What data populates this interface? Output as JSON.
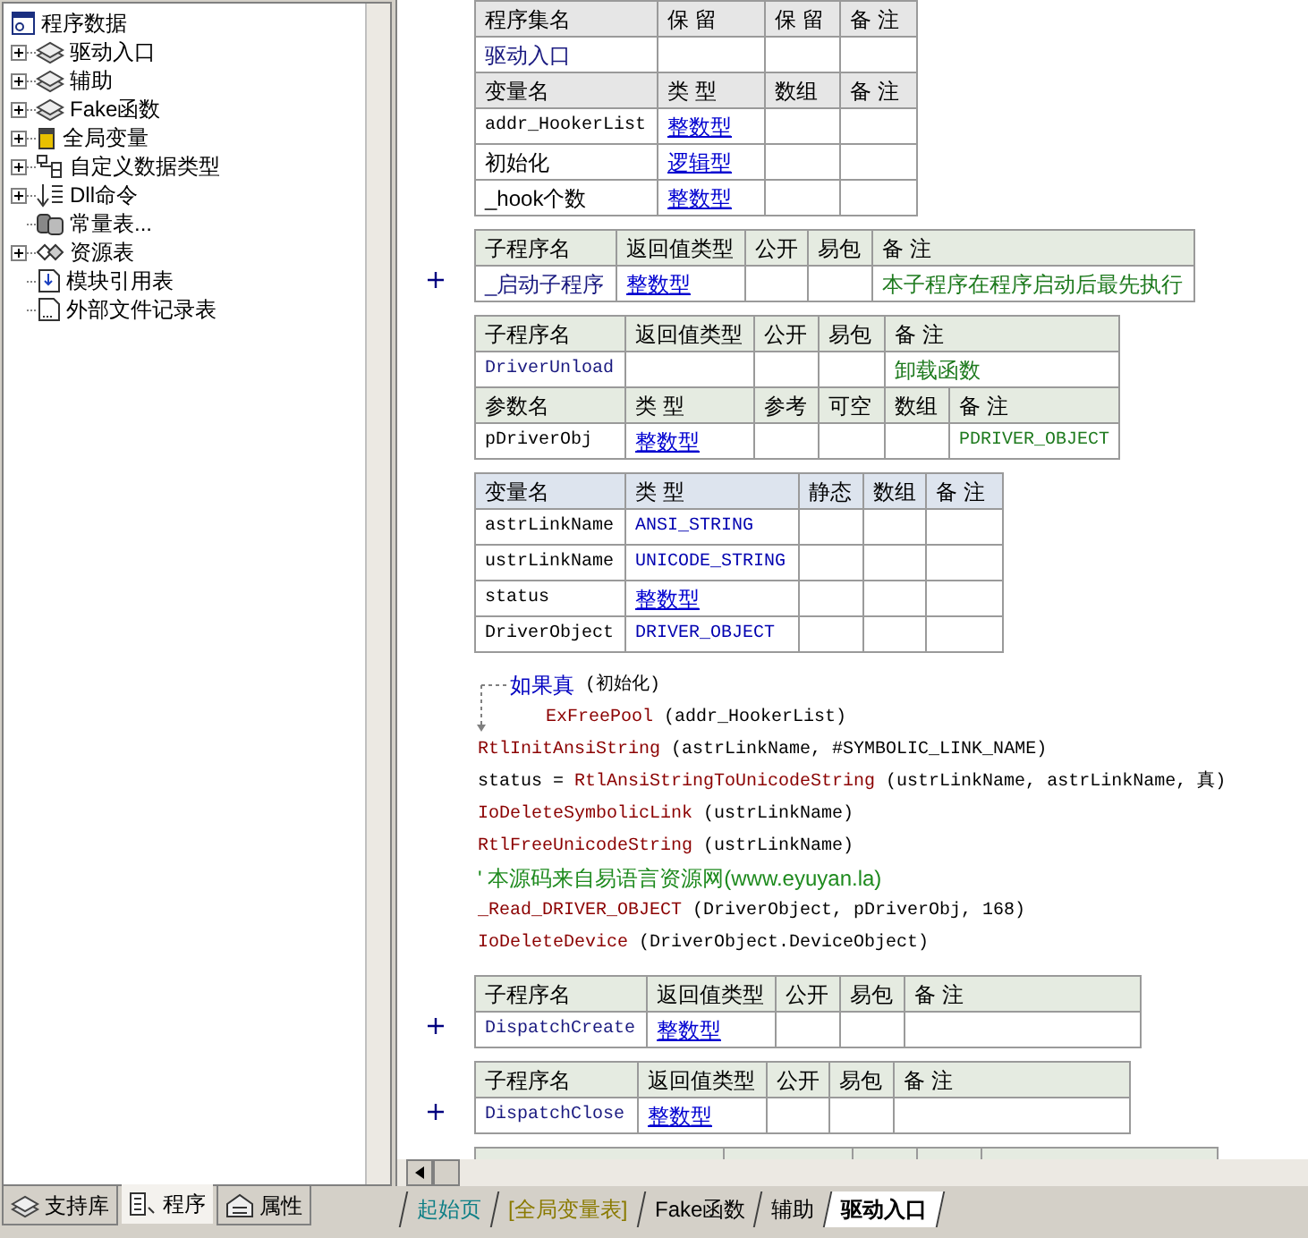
{
  "tree": {
    "label": "程序数据",
    "children": [
      {
        "label": "驱动入口",
        "kind": "module",
        "expandable": true
      },
      {
        "label": "辅助",
        "kind": "module",
        "expandable": true
      },
      {
        "label": "Fake函数",
        "kind": "module",
        "expandable": true
      },
      {
        "label": "全局变量",
        "kind": "global",
        "expandable": true
      },
      {
        "label": "自定义数据类型",
        "kind": "datatype",
        "expandable": true
      },
      {
        "label": "Dll命令",
        "kind": "dll",
        "expandable": true
      },
      {
        "label": "常量表...",
        "kind": "constant",
        "expandable": false
      },
      {
        "label": "资源表",
        "kind": "resource",
        "expandable": true
      },
      {
        "label": "模块引用表",
        "kind": "modref",
        "expandable": false
      },
      {
        "label": "外部文件记录表",
        "kind": "file",
        "expandable": false
      }
    ]
  },
  "panel_tabs": [
    {
      "label": "支持库",
      "kind": "library",
      "selected": false
    },
    {
      "label": "程序",
      "kind": "program",
      "selected": true
    },
    {
      "label": "属性",
      "kind": "properties",
      "selected": false
    }
  ],
  "blocks": [
    {
      "kind": "assembly",
      "rows": [
        {
          "cells": [
            {
              "kind": "head",
              "text": "程序集名"
            },
            {
              "kind": "head",
              "text": "保 留"
            },
            {
              "kind": "head",
              "text": "保 留"
            },
            {
              "kind": "head",
              "text": "备 注"
            }
          ]
        },
        {
          "cells": [
            {
              "kind": "name",
              "text": "驱动入口"
            },
            {},
            {},
            {}
          ]
        },
        {
          "cells": [
            {
              "kind": "head",
              "text": "变量名"
            },
            {
              "kind": "head",
              "text": "类 型"
            },
            {
              "kind": "head",
              "text": "数组"
            },
            {
              "kind": "head",
              "text": "备 注"
            }
          ]
        },
        {
          "cells": [
            {
              "kind": "mono",
              "text": "addr_HookerList"
            },
            {
              "kind": "type",
              "text": "整数型"
            },
            {},
            {}
          ]
        },
        {
          "cells": [
            {
              "kind": "text",
              "text": "初始化"
            },
            {
              "kind": "type",
              "text": "逻辑型"
            },
            {},
            {}
          ]
        },
        {
          "cells": [
            {
              "kind": "text",
              "text": "_hook个数"
            },
            {
              "kind": "type",
              "text": "整数型"
            },
            {},
            {}
          ]
        }
      ]
    },
    {
      "kind": "subroutine",
      "expanded": false,
      "rows": [
        {
          "cells": [
            {
              "kind": "head",
              "text": "子程序名"
            },
            {
              "kind": "head",
              "text": "返回值类型"
            },
            {
              "kind": "head",
              "text": "公开"
            },
            {
              "kind": "head",
              "text": "易包"
            },
            {
              "kind": "head",
              "text": "备 注"
            }
          ]
        },
        {
          "cells": [
            {
              "kind": "name",
              "text": "_启动子程序"
            },
            {
              "kind": "type",
              "text": "整数型"
            },
            {},
            {},
            {
              "kind": "note",
              "text": "本子程序在程序启动后最先执行"
            }
          ]
        }
      ]
    },
    {
      "kind": "subroutine",
      "expanded": true,
      "rows": [
        {
          "cells": [
            {
              "kind": "head",
              "text": "子程序名"
            },
            {
              "kind": "head",
              "text": "返回值类型"
            },
            {
              "kind": "head",
              "text": "公开"
            },
            {
              "kind": "head",
              "text": "易包"
            },
            {
              "kind": "head",
              "text": "备 注"
            }
          ]
        },
        {
          "cells": [
            {
              "kind": "name_mono",
              "text": "DriverUnload"
            },
            {},
            {},
            {},
            {
              "kind": "note",
              "text": "卸载函数"
            }
          ]
        },
        {
          "cells": [
            {
              "kind": "head",
              "text": "参数名"
            },
            {
              "kind": "head",
              "text": "类 型"
            },
            {
              "kind": "head",
              "text": "参考"
            },
            {
              "kind": "head",
              "text": "可空"
            },
            {
              "kind": "head",
              "text": "数组"
            },
            {
              "kind": "head",
              "text": "备 注"
            }
          ]
        },
        {
          "cells": [
            {
              "kind": "mono",
              "text": "pDriverObj"
            },
            {
              "kind": "type",
              "text": "整数型"
            },
            {},
            {},
            {},
            {
              "kind": "note_mono",
              "text": "PDRIVER_OBJECT"
            }
          ]
        }
      ]
    },
    {
      "kind": "locals",
      "rows": [
        {
          "cells": [
            {
              "kind": "head",
              "text": "变量名"
            },
            {
              "kind": "head",
              "text": "类 型"
            },
            {
              "kind": "head",
              "text": "静态"
            },
            {
              "kind": "head",
              "text": "数组"
            },
            {
              "kind": "head",
              "text": "备 注"
            }
          ]
        },
        {
          "cells": [
            {
              "kind": "mono",
              "text": "astrLinkName"
            },
            {
              "kind": "type_mono",
              "text": "ANSI_STRING"
            },
            {},
            {},
            {}
          ]
        },
        {
          "cells": [
            {
              "kind": "mono",
              "text": "ustrLinkName"
            },
            {
              "kind": "type_mono",
              "text": "UNICODE_STRING"
            },
            {},
            {},
            {}
          ]
        },
        {
          "cells": [
            {
              "kind": "mono",
              "text": "status"
            },
            {
              "kind": "type",
              "text": "整数型"
            },
            {},
            {},
            {}
          ]
        },
        {
          "cells": [
            {
              "kind": "mono",
              "text": "DriverObject"
            },
            {
              "kind": "type_mono",
              "text": "DRIVER_OBJECT"
            },
            {},
            {},
            {}
          ]
        }
      ]
    },
    {
      "kind": "code",
      "lines": [
        {
          "parts": [
            {
              "kind": "keyword",
              "text": "如果真"
            },
            {
              "kind": "plain",
              "text": " (初始化)"
            }
          ],
          "children": [
            {
              "parts": [
                {
                  "kind": "func",
                  "text": "ExFreePool"
                },
                {
                  "kind": "plain",
                  "text": " (addr_HookerList)"
                }
              ]
            }
          ]
        },
        {
          "parts": [
            {
              "kind": "func",
              "text": "RtlInitAnsiString"
            },
            {
              "kind": "plain",
              "text": " (astrLinkName, #SYMBOLIC_LINK_NAME)"
            }
          ]
        },
        {
          "parts": [
            {
              "kind": "plain",
              "text": "status = "
            },
            {
              "kind": "func",
              "text": "RtlAnsiStringToUnicodeString"
            },
            {
              "kind": "plain",
              "text": " (ustrLinkName, astrLinkName, 真)"
            }
          ]
        },
        {
          "parts": [
            {
              "kind": "func",
              "text": "IoDeleteSymbolicLink"
            },
            {
              "kind": "plain",
              "text": " (ustrLinkName)"
            }
          ]
        },
        {
          "parts": [
            {
              "kind": "func",
              "text": "RtlFreeUnicodeString"
            },
            {
              "kind": "plain",
              "text": " (ustrLinkName)"
            }
          ]
        },
        {
          "parts": [
            {
              "kind": "comment",
              "text": "' 本源码来自易语言资源网(www.eyuyan.la)"
            }
          ]
        },
        {
          "parts": [
            {
              "kind": "func",
              "text": "_Read_DRIVER_OBJECT"
            },
            {
              "kind": "plain",
              "text": " (DriverObject, pDriverObj, 168)"
            }
          ]
        },
        {
          "parts": [
            {
              "kind": "func",
              "text": "IoDeleteDevice"
            },
            {
              "kind": "plain",
              "text": " (DriverObject.DeviceObject)"
            }
          ]
        }
      ]
    },
    {
      "kind": "subroutine",
      "expanded": false,
      "rows": [
        {
          "cells": [
            {
              "kind": "head",
              "text": "子程序名"
            },
            {
              "kind": "head",
              "text": "返回值类型"
            },
            {
              "kind": "head",
              "text": "公开"
            },
            {
              "kind": "head",
              "text": "易包"
            },
            {
              "kind": "head",
              "text": "备 注"
            }
          ]
        },
        {
          "cells": [
            {
              "kind": "name_mono",
              "text": "DispatchCreate"
            },
            {
              "kind": "type",
              "text": "整数型"
            },
            {},
            {},
            {}
          ]
        }
      ]
    },
    {
      "kind": "subroutine",
      "expanded": false,
      "rows": [
        {
          "cells": [
            {
              "kind": "head",
              "text": "子程序名"
            },
            {
              "kind": "head",
              "text": "返回值类型"
            },
            {
              "kind": "head",
              "text": "公开"
            },
            {
              "kind": "head",
              "text": "易包"
            },
            {
              "kind": "head",
              "text": "备 注"
            }
          ]
        },
        {
          "cells": [
            {
              "kind": "name_mono",
              "text": "DispatchClose"
            },
            {
              "kind": "type",
              "text": "整数型"
            },
            {},
            {},
            {}
          ]
        }
      ]
    },
    {
      "kind": "table_edge"
    }
  ],
  "file_tabs": [
    {
      "label": "起始页",
      "color": "#0e7f86",
      "selected": false
    },
    {
      "label": "[全局变量表]",
      "color": "#8a7a00",
      "selected": false
    },
    {
      "label": "Fake函数",
      "color": "#000000",
      "selected": false
    },
    {
      "label": "辅助",
      "color": "#000000",
      "selected": false
    },
    {
      "label": "驱动入口",
      "color": "#000000",
      "selected": true
    }
  ]
}
